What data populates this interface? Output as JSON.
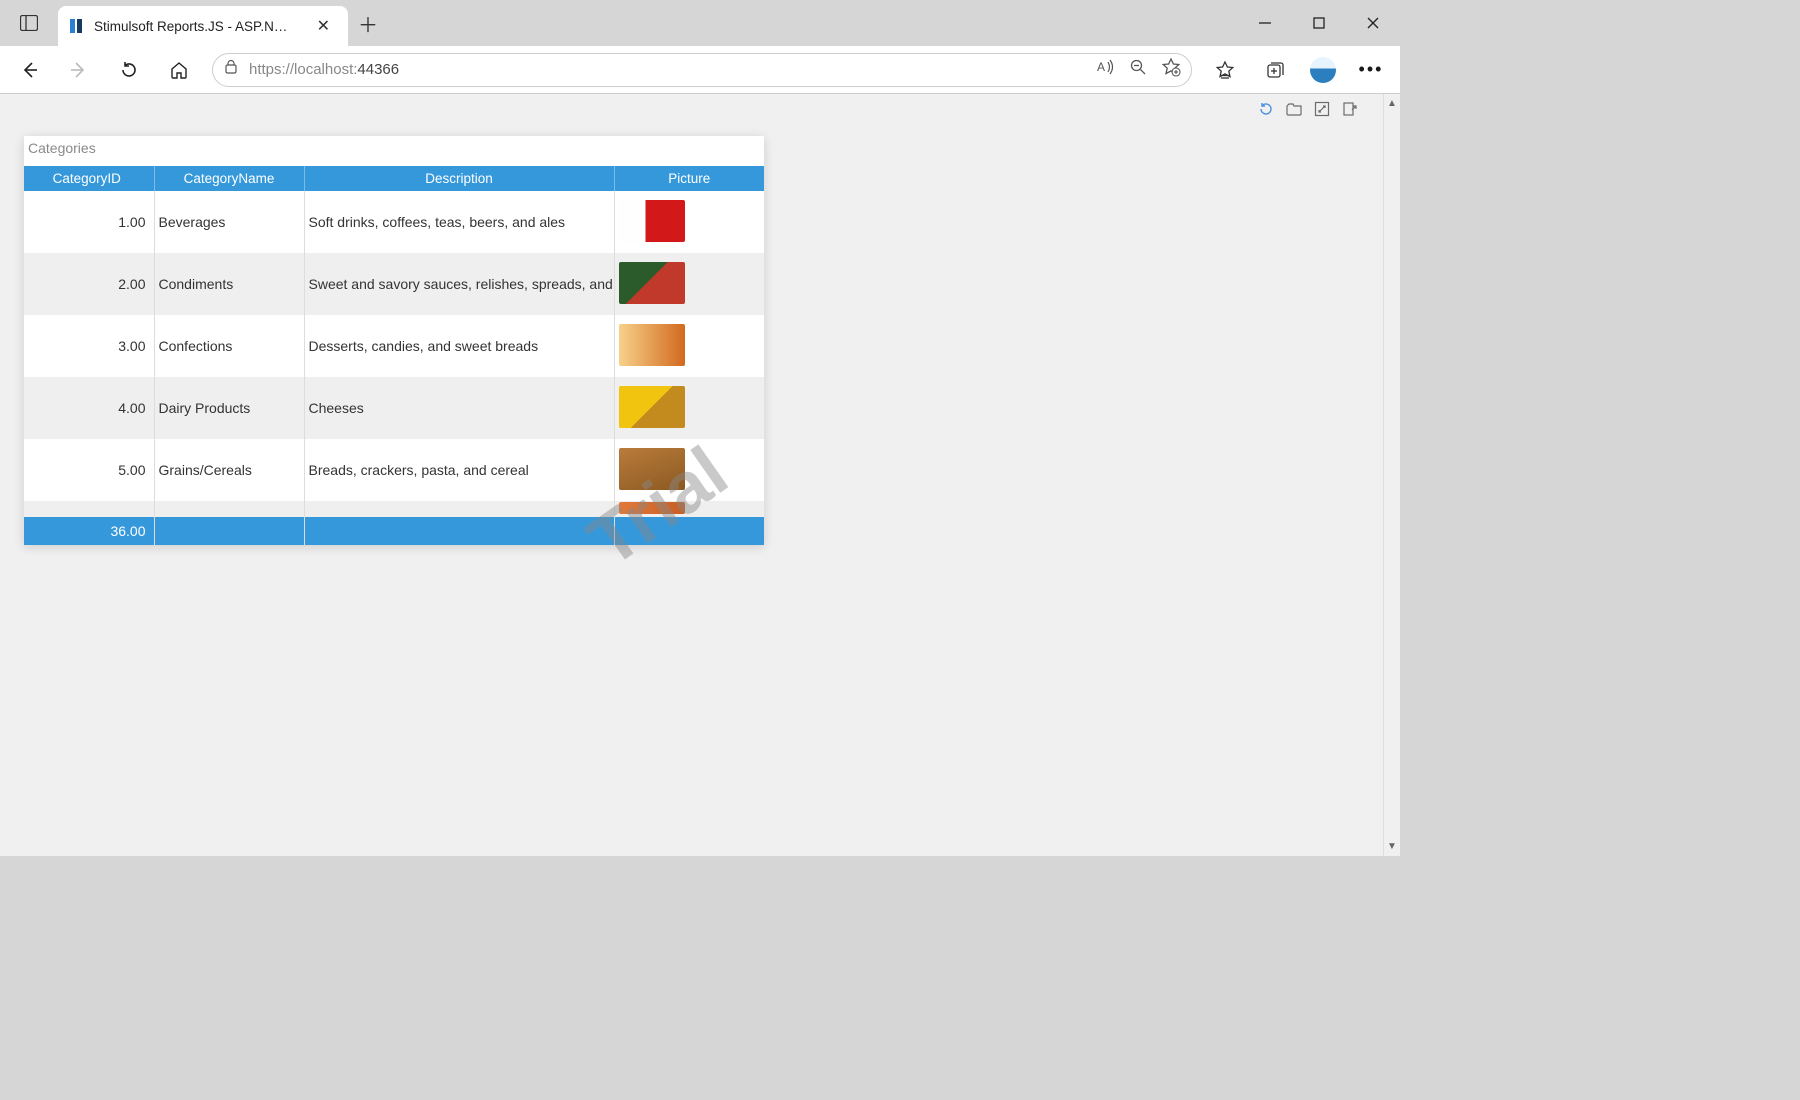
{
  "browser": {
    "tab_title": "Stimulsoft Reports.JS - ASP.NET D",
    "url_scheme": "https://",
    "url_host": "localhost:",
    "url_port": "44366"
  },
  "devpanel": {
    "labels": [
      "refresh",
      "open",
      "resize",
      "export"
    ]
  },
  "report": {
    "title": "Categories",
    "watermark": "Trial",
    "columns": [
      "CategoryID",
      "CategoryName",
      "Description",
      "Picture"
    ],
    "rows": [
      {
        "id": "1.00",
        "name": "Beverages",
        "desc": "Soft drinks, coffees, teas, beers, and ales",
        "thumb": "th-1"
      },
      {
        "id": "2.00",
        "name": "Condiments",
        "desc": "Sweet and savory sauces, relishes, spreads, and s",
        "thumb": "th-2"
      },
      {
        "id": "3.00",
        "name": "Confections",
        "desc": "Desserts, candies, and sweet breads",
        "thumb": "th-3"
      },
      {
        "id": "4.00",
        "name": "Dairy Products",
        "desc": "Cheeses",
        "thumb": "th-4"
      },
      {
        "id": "5.00",
        "name": "Grains/Cereals",
        "desc": "Breads, crackers, pasta, and cereal",
        "thumb": "th-5"
      }
    ],
    "footer_total": "36.00"
  }
}
